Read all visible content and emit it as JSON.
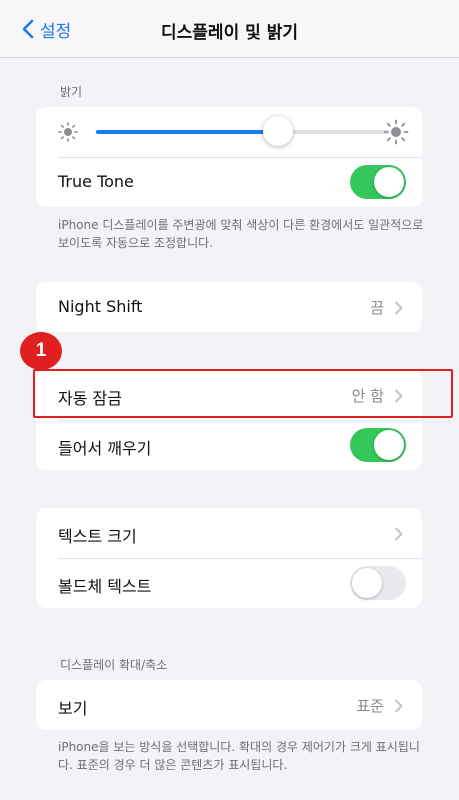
{
  "navbar": {
    "back_label": "설정",
    "title": "디스플레이 및 밝기"
  },
  "brightness": {
    "header": "밝기",
    "level_percent": 62,
    "true_tone_label": "True Tone",
    "true_tone_on": true,
    "footer": "iPhone 디스플레이를 주변광에 맞춰 색상이 다른 환경에서도 일관적으로 보이도록 자동으로 조정합니다."
  },
  "night_shift": {
    "label": "Night Shift",
    "value": "끔"
  },
  "annotation": {
    "step_number": "1",
    "highlight_color": "#e02020"
  },
  "lock": {
    "auto_lock_label": "자동 잠금",
    "auto_lock_value": "안 함",
    "raise_to_wake_label": "들어서 깨우기",
    "raise_to_wake_on": true
  },
  "text": {
    "text_size_label": "텍스트 크기",
    "bold_text_label": "볼드체 텍스트",
    "bold_text_on": false
  },
  "zoom": {
    "header": "디스플레이 확대/축소",
    "view_label": "보기",
    "view_value": "표준",
    "footer": "iPhone을 보는 방식을 선택합니다. 확대의 경우 제어기가 크게 표시됩니다. 표준의 경우 더 많은 콘텐츠가 표시됩니다."
  },
  "colors": {
    "accent": "#1a7af0",
    "toggle_on": "#34c759",
    "background": "#f2f2f7"
  }
}
